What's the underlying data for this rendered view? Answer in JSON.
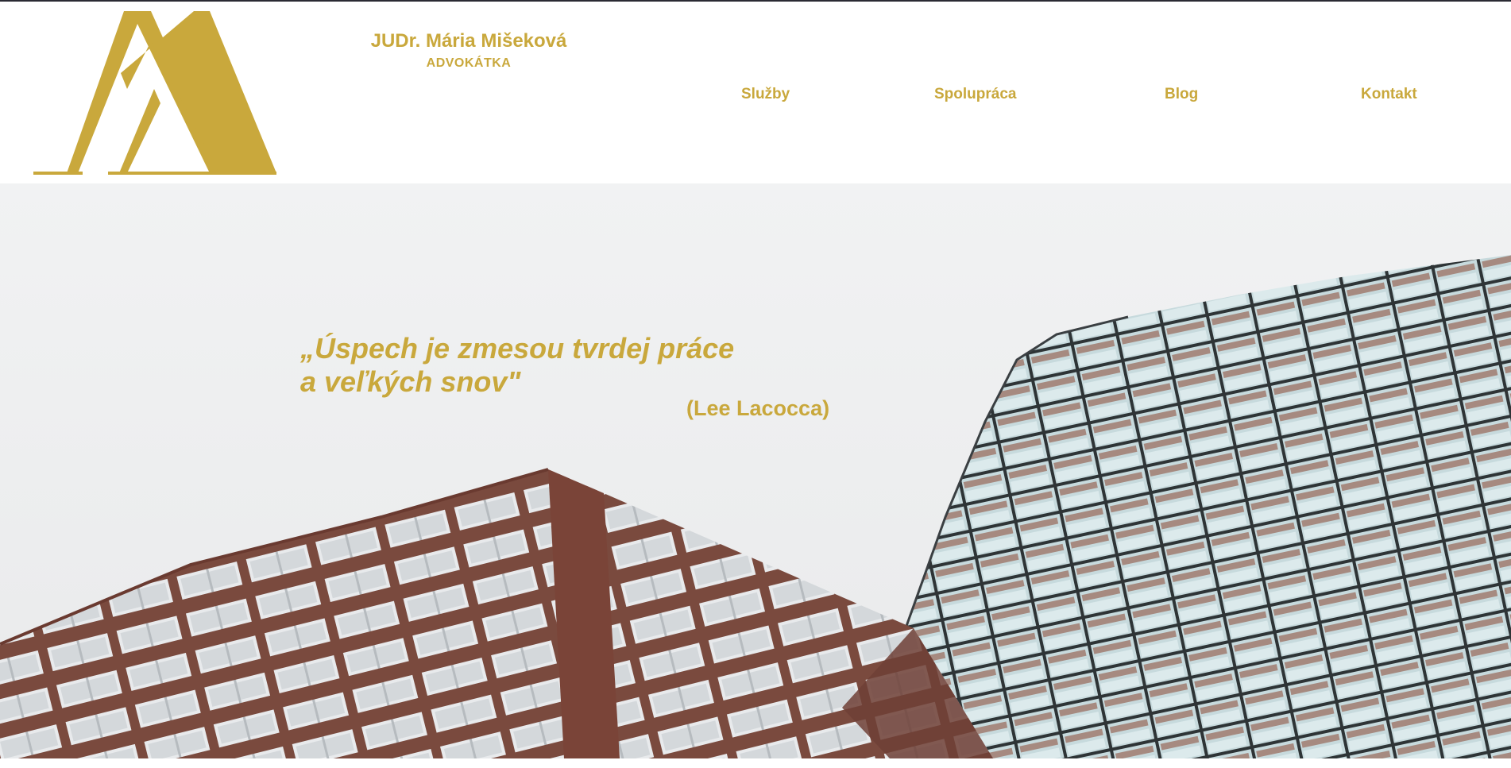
{
  "brand": {
    "name": "JUDr. Mária Mišeková",
    "subtitle": "ADVOKÁTKA",
    "logo_icon": "double-a-monogram-icon"
  },
  "nav": {
    "items": [
      {
        "label": "Služby"
      },
      {
        "label": "Spolupráca"
      },
      {
        "label": "Blog"
      },
      {
        "label": "Kontakt"
      }
    ]
  },
  "hero": {
    "quote_line1": "„Úspech je zmesou tvrdej práce",
    "quote_line2": "a veľkých snov\"",
    "quote_author": "(Lee Lacocca)",
    "image_icon": "office-buildings-photo"
  },
  "colors": {
    "accent": "#c9a83c",
    "sky": "#eeeff1",
    "brick": "#7a4a3e",
    "glass": "#c9dde0"
  }
}
